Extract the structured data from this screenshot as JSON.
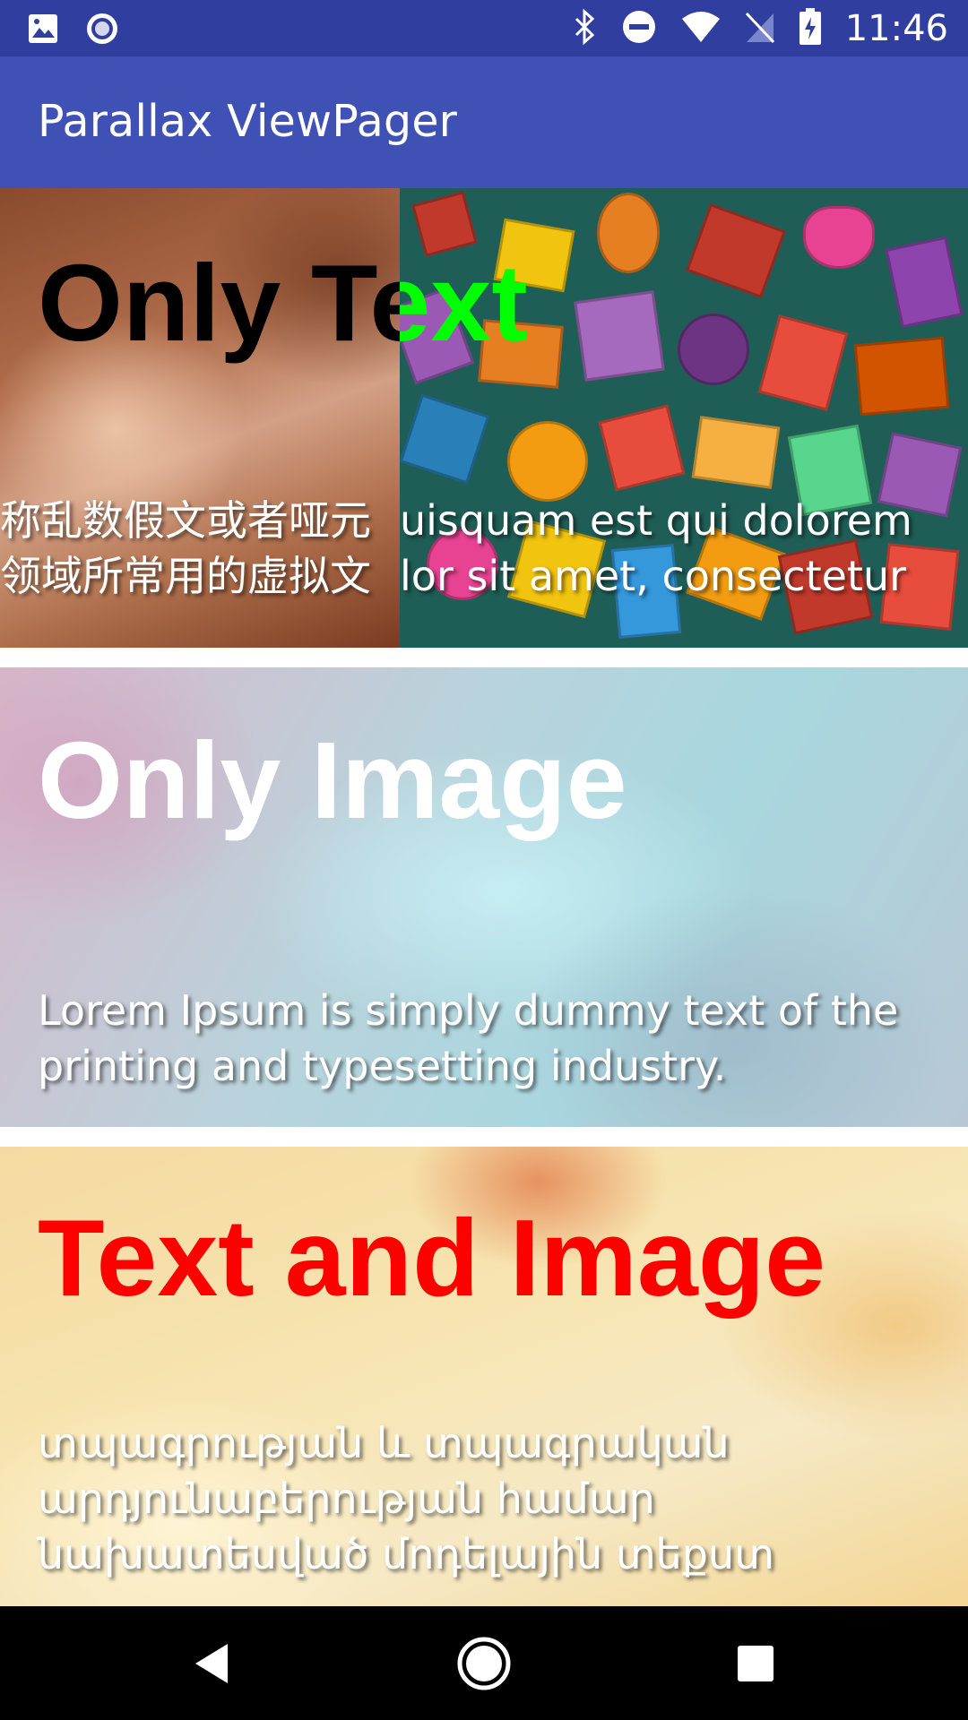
{
  "status_bar": {
    "time": "11:46",
    "left_icons": [
      "image-icon",
      "radio-record-icon"
    ],
    "right_icons": [
      "bluetooth-icon",
      "do-not-disturb-icon",
      "wifi-icon",
      "no-sim-icon",
      "battery-charging-icon"
    ]
  },
  "app_bar": {
    "title": "Parallax ViewPager",
    "color": "#3f51b5",
    "status_color": "#303f9f"
  },
  "cards": [
    {
      "title": "Only Text",
      "title_color_left": "#000000",
      "title_color_right": "#00ff00",
      "body_left": "称乱数假文或者哑元\n领域所常用的虚拟文",
      "body_right": "uisquam est qui dolorem\nlor sit amet, consectetur"
    },
    {
      "title": "Only Image",
      "title_color": "#ffffff",
      "body": "Lorem Ipsum is simply dummy text of the printing and typesetting industry."
    },
    {
      "title": "Text and Image",
      "title_color": "#ff0000",
      "body": "տպագրության և տպագրական արդյունաբերության համար նախատեսված մոդելային տեքստ"
    }
  ],
  "nav_bar": {
    "back": "back-icon",
    "home": "home-icon",
    "recents": "recents-icon"
  }
}
